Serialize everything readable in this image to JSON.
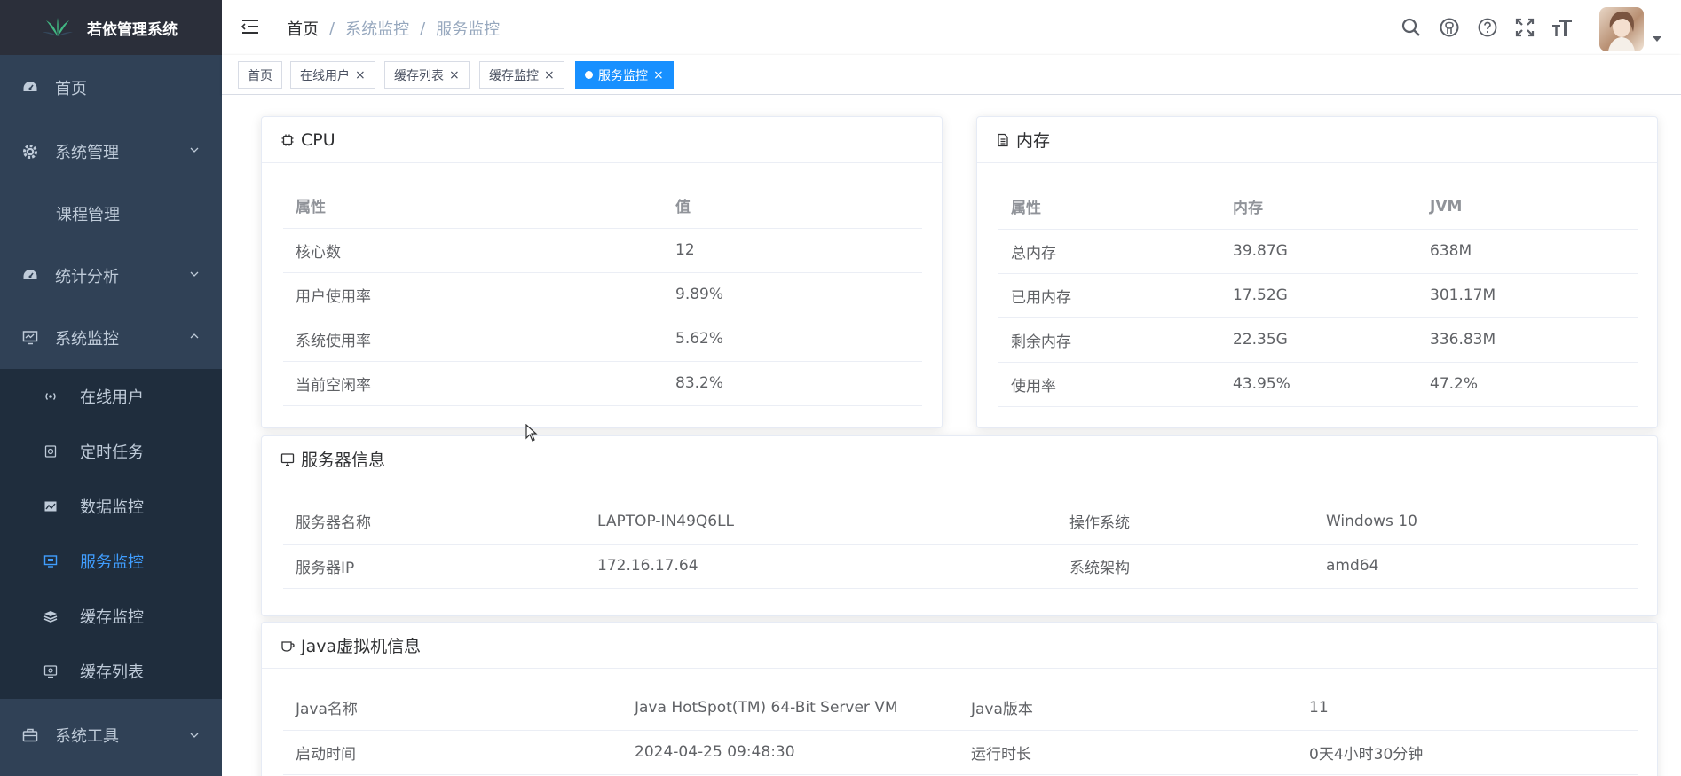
{
  "app": {
    "title": "若依管理系统"
  },
  "sidebar": {
    "home": "首页",
    "system_mgmt": "系统管理",
    "course_mgmt": "课程管理",
    "stats": "统计分析",
    "monitor": "系统监控",
    "monitor_items": [
      "在线用户",
      "定时任务",
      "数据监控",
      "服务监控",
      "缓存监控",
      "缓存列表"
    ],
    "tools": "系统工具"
  },
  "breadcrumb": [
    "首页",
    "系统监控",
    "服务监控"
  ],
  "tags": [
    "首页",
    "在线用户",
    "缓存列表",
    "缓存监控",
    "服务监控"
  ],
  "cpu": {
    "title": "CPU",
    "headers": [
      "属性",
      "值"
    ],
    "rows": [
      [
        "核心数",
        "12"
      ],
      [
        "用户使用率",
        "9.89%"
      ],
      [
        "系统使用率",
        "5.62%"
      ],
      [
        "当前空闲率",
        "83.2%"
      ]
    ]
  },
  "memory": {
    "title": "内存",
    "headers": [
      "属性",
      "内存",
      "JVM"
    ],
    "rows": [
      [
        "总内存",
        "39.87G",
        "638M"
      ],
      [
        "已用内存",
        "17.52G",
        "301.17M"
      ],
      [
        "剩余内存",
        "22.35G",
        "336.83M"
      ],
      [
        "使用率",
        "43.95%",
        "47.2%"
      ]
    ]
  },
  "server": {
    "title": "服务器信息",
    "rows": [
      [
        "服务器名称",
        "LAPTOP-IN49Q6LL",
        "操作系统",
        "Windows 10"
      ],
      [
        "服务器IP",
        "172.16.17.64",
        "系统架构",
        "amd64"
      ]
    ]
  },
  "jvm": {
    "title": "Java虚拟机信息",
    "rows": [
      [
        "Java名称",
        "Java HotSpot(TM) 64-Bit Server VM",
        "Java版本",
        "11"
      ],
      [
        "启动时间",
        "2024-04-25 09:48:30",
        "运行时长",
        "0天4小时30分钟"
      ]
    ]
  },
  "colors": {
    "sidebar_bg": "#304156",
    "submenu_bg": "#1f2d3d",
    "accent": "#409eff",
    "tag_active": "#1890ff"
  }
}
